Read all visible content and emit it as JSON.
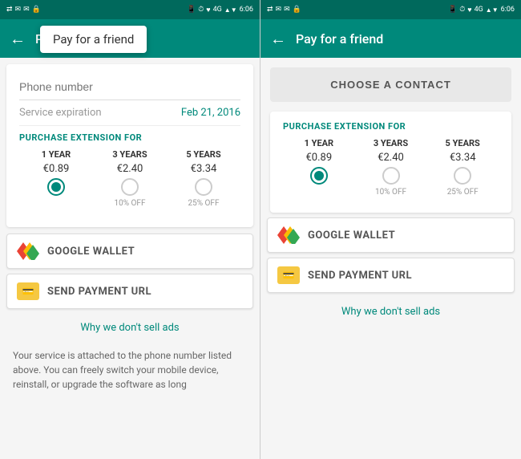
{
  "left_screen": {
    "status_bar": {
      "left_icons": "⇄ ✉ ✉ 🔒",
      "right_icons": "📱 ⏱ ♥ 4G ▲▼ 6:06"
    },
    "toolbar": {
      "back_label": "←",
      "title": "Payment in...",
      "tooltip": "Pay for a friend"
    },
    "phone_field": {
      "placeholder": "Phone number"
    },
    "service_expiry": {
      "label": "Service expiration",
      "date": "Feb 21, 2016"
    },
    "purchase_section": {
      "title": "PURCHASE EXTENSION FOR",
      "options": [
        {
          "years": "1 YEAR",
          "price": "€0.89",
          "discount": "",
          "selected": true
        },
        {
          "years": "3 YEARS",
          "price": "€2.40",
          "discount": "10% OFF",
          "selected": false
        },
        {
          "years": "5 YEARS",
          "price": "€3.34",
          "discount": "25% OFF",
          "selected": false
        }
      ]
    },
    "payment_buttons": [
      {
        "id": "google-wallet",
        "label": "GOOGLE WALLET"
      },
      {
        "id": "send-payment",
        "label": "SEND PAYMENT URL"
      }
    ],
    "link": "Why we don't sell ads",
    "footer_text": "Your service is attached to the phone number listed above. You can freely switch your mobile device, reinstall, or upgrade the software as long"
  },
  "right_screen": {
    "status_bar": {
      "left_icons": "⇄ ✉ ✉ 🔒",
      "right_icons": "📱 ⏱ ♥ 4G ▲▼ 6:06"
    },
    "toolbar": {
      "back_label": "←",
      "title": "Pay for a friend"
    },
    "choose_contact_btn": "CHOOSE A CONTACT",
    "purchase_section": {
      "title": "PURCHASE EXTENSION FOR",
      "options": [
        {
          "years": "1 YEAR",
          "price": "€0.89",
          "discount": "",
          "selected": true
        },
        {
          "years": "3 YEARS",
          "price": "€2.40",
          "discount": "10% OFF",
          "selected": false
        },
        {
          "years": "5 YEARS",
          "price": "€3.34",
          "discount": "25% OFF",
          "selected": false
        }
      ]
    },
    "payment_buttons": [
      {
        "id": "google-wallet",
        "label": "GOOGLE WALLET"
      },
      {
        "id": "send-payment",
        "label": "SEND PAYMENT URL"
      }
    ],
    "link": "Why we don't sell ads"
  }
}
